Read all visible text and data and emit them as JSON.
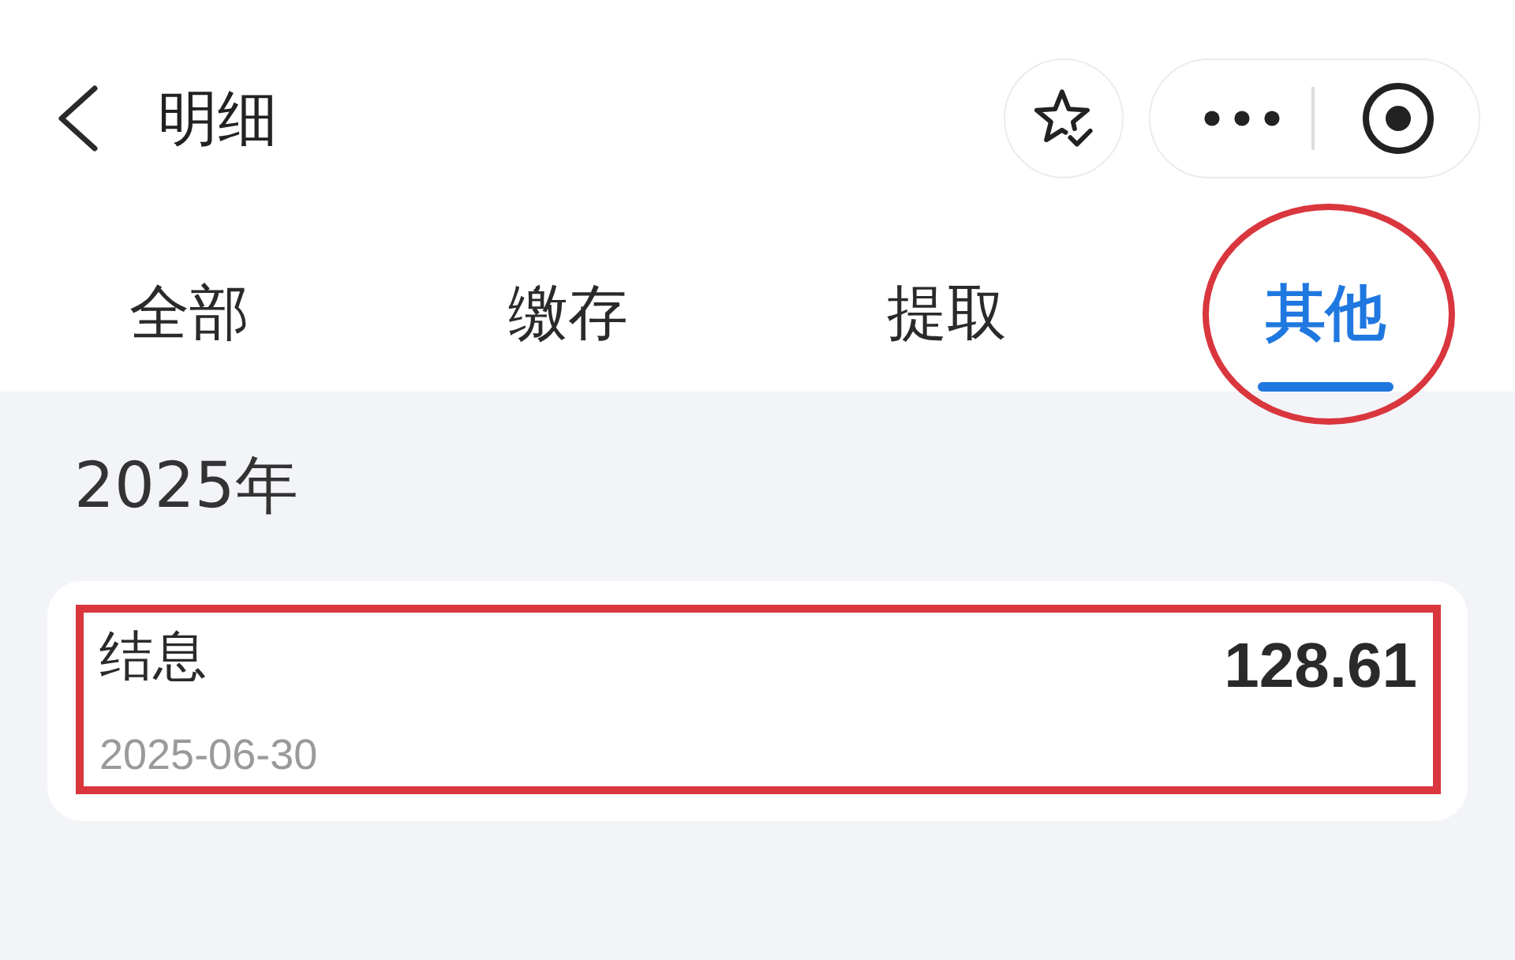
{
  "header": {
    "title": "明细"
  },
  "tabs": [
    {
      "label": "全部",
      "selected": false,
      "circled": false
    },
    {
      "label": "缴存",
      "selected": false,
      "circled": false
    },
    {
      "label": "提取",
      "selected": false,
      "circled": false
    },
    {
      "label": "其他",
      "selected": true,
      "circled": true
    }
  ],
  "groups": [
    {
      "year": "2025年",
      "records": [
        {
          "title": "结息",
          "date": "2025-06-30",
          "amount": "128.61",
          "boxed": true
        }
      ]
    }
  ]
}
